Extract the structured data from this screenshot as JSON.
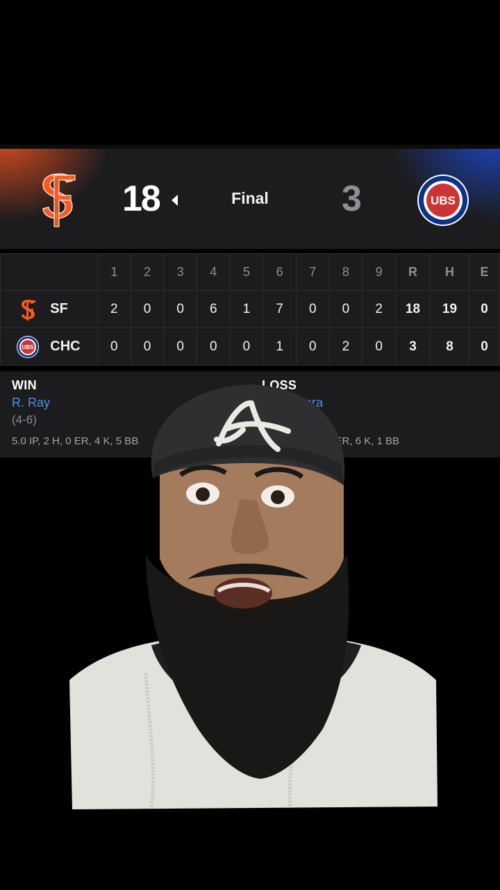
{
  "game": {
    "away_team": "SF",
    "home_team": "CHC",
    "away_score": "18",
    "home_score": "3",
    "status": "Final"
  },
  "box_score": {
    "innings": [
      "1",
      "2",
      "3",
      "4",
      "5",
      "6",
      "7",
      "8",
      "9"
    ],
    "totals_headers": [
      "R",
      "H",
      "E"
    ],
    "rows": [
      {
        "team": "SF",
        "innings": [
          "2",
          "0",
          "0",
          "6",
          "1",
          "7",
          "0",
          "0",
          "2"
        ],
        "totals": [
          "18",
          "19",
          "0"
        ]
      },
      {
        "team": "CHC",
        "innings": [
          "0",
          "0",
          "0",
          "0",
          "0",
          "1",
          "0",
          "2",
          "0"
        ],
        "totals": [
          "3",
          "8",
          "0"
        ]
      }
    ]
  },
  "pitchers": {
    "win": {
      "heading": "WIN",
      "name": "R. Ray",
      "record": "(4-6)",
      "line": "5.0 IP, 2 H, 0 ER, 4 K, 5 BB"
    },
    "loss": {
      "heading": "LOSS",
      "name": "brera",
      "line": "8 ER, 6 K, 1 BB"
    }
  },
  "colors": {
    "giants_orange": "#fd5a1e",
    "cubs_blue": "#0e3386",
    "cubs_red": "#cc3433",
    "link_blue": "#4a90e2"
  },
  "icons": {
    "sf_logo": "giants-sf-logo-icon",
    "chc_logo": "cubs-logo-icon",
    "winner_indicator": "caret-left-icon"
  }
}
